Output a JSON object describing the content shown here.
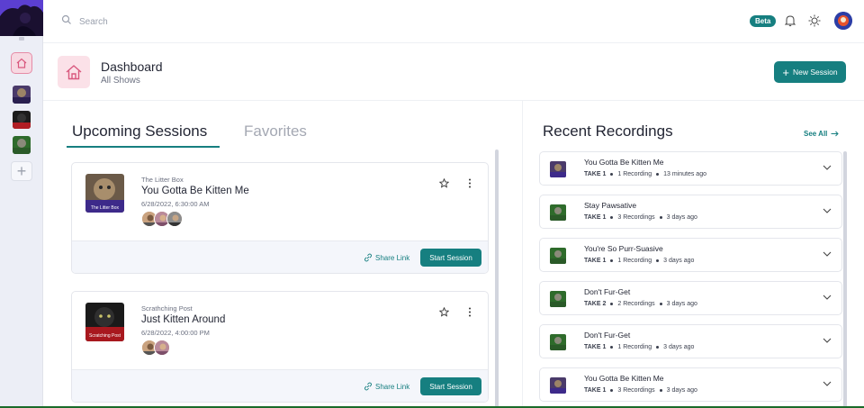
{
  "colors": {
    "accent": "#167f80",
    "pink": "#fbe1e8",
    "sidebar": "#eceef6"
  },
  "topbar": {
    "search_placeholder": "Search",
    "beta": "Beta"
  },
  "header": {
    "title": "Dashboard",
    "subtitle": "All Shows",
    "new_session": "New Session"
  },
  "tabs": {
    "upcoming": "Upcoming Sessions",
    "favorites": "Favorites"
  },
  "sessions": [
    {
      "show": "The Litter Box",
      "title": "You Gotta Be Kitten Me",
      "date": "6/28/2022, 6:30:00 AM",
      "share": "Share Link",
      "start": "Start Session",
      "thumb_text": "The Litter Box"
    },
    {
      "show": "Scrathching Post",
      "title": "Just Kitten Around",
      "date": "6/28/2022, 4:00:00 PM",
      "share": "Share Link",
      "start": "Start Session",
      "thumb_text": "Scratching Post"
    }
  ],
  "recent": {
    "title": "Recent Recordings",
    "see_all": "See All",
    "items": [
      {
        "title": "You Gotta Be Kitten Me",
        "take": "TAKE 1",
        "count": "1 Recording",
        "time": "13 minutes ago"
      },
      {
        "title": "Stay Pawsative",
        "take": "TAKE 1",
        "count": "3 Recordings",
        "time": "3 days ago"
      },
      {
        "title": "You're So Purr-Suasive",
        "take": "TAKE 1",
        "count": "1 Recording",
        "time": "3 days ago"
      },
      {
        "title": "Don't Fur-Get",
        "take": "TAKE 2",
        "count": "2 Recordings",
        "time": "3 days ago"
      },
      {
        "title": "Don't Fur-Get",
        "take": "TAKE 1",
        "count": "1 Recording",
        "time": "3 days ago"
      },
      {
        "title": "You Gotta Be Kitten Me",
        "take": "TAKE 1",
        "count": "3 Recordings",
        "time": "3 days ago"
      }
    ]
  }
}
